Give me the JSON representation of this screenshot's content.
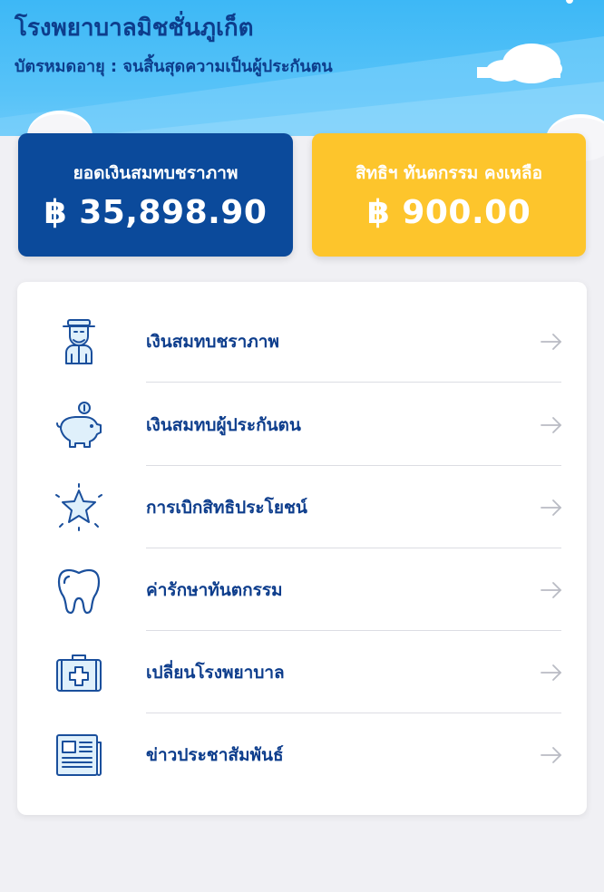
{
  "header": {
    "hospital_name": "โรงพยาบาลมิชชั่นภูเก็ต",
    "card_expiry": "บัตรหมดอายุ : จนสิ้นสุดความเป็นผู้ประกันตน"
  },
  "summary": {
    "elderly": {
      "label": "ยอดเงินสมทบชราภาพ",
      "amount": "฿ 35,898.90",
      "color": "#0b4a9b"
    },
    "dental": {
      "label": "สิทธิฯ ทันตกรรม คงเหลือ",
      "amount": "฿ 900.00",
      "color": "#fdc52c"
    }
  },
  "menu": {
    "items": [
      {
        "label": "เงินสมทบชราภาพ",
        "icon": "elderly-man-icon"
      },
      {
        "label": "เงินสมทบผู้ประกันตน",
        "icon": "piggy-bank-icon"
      },
      {
        "label": "การเบิกสิทธิประโยชน์",
        "icon": "star-icon"
      },
      {
        "label": "ค่ารักษาทันตกรรม",
        "icon": "tooth-icon"
      },
      {
        "label": "เปลี่ยนโรงพยาบาล",
        "icon": "medical-kit-icon"
      },
      {
        "label": "ข่าวประชาสัมพันธ์",
        "icon": "newspaper-icon"
      }
    ]
  },
  "colors": {
    "brand_dark_blue": "#0d3d8c",
    "sky": "#3db8f6",
    "icon_blue": "#1565c0"
  }
}
